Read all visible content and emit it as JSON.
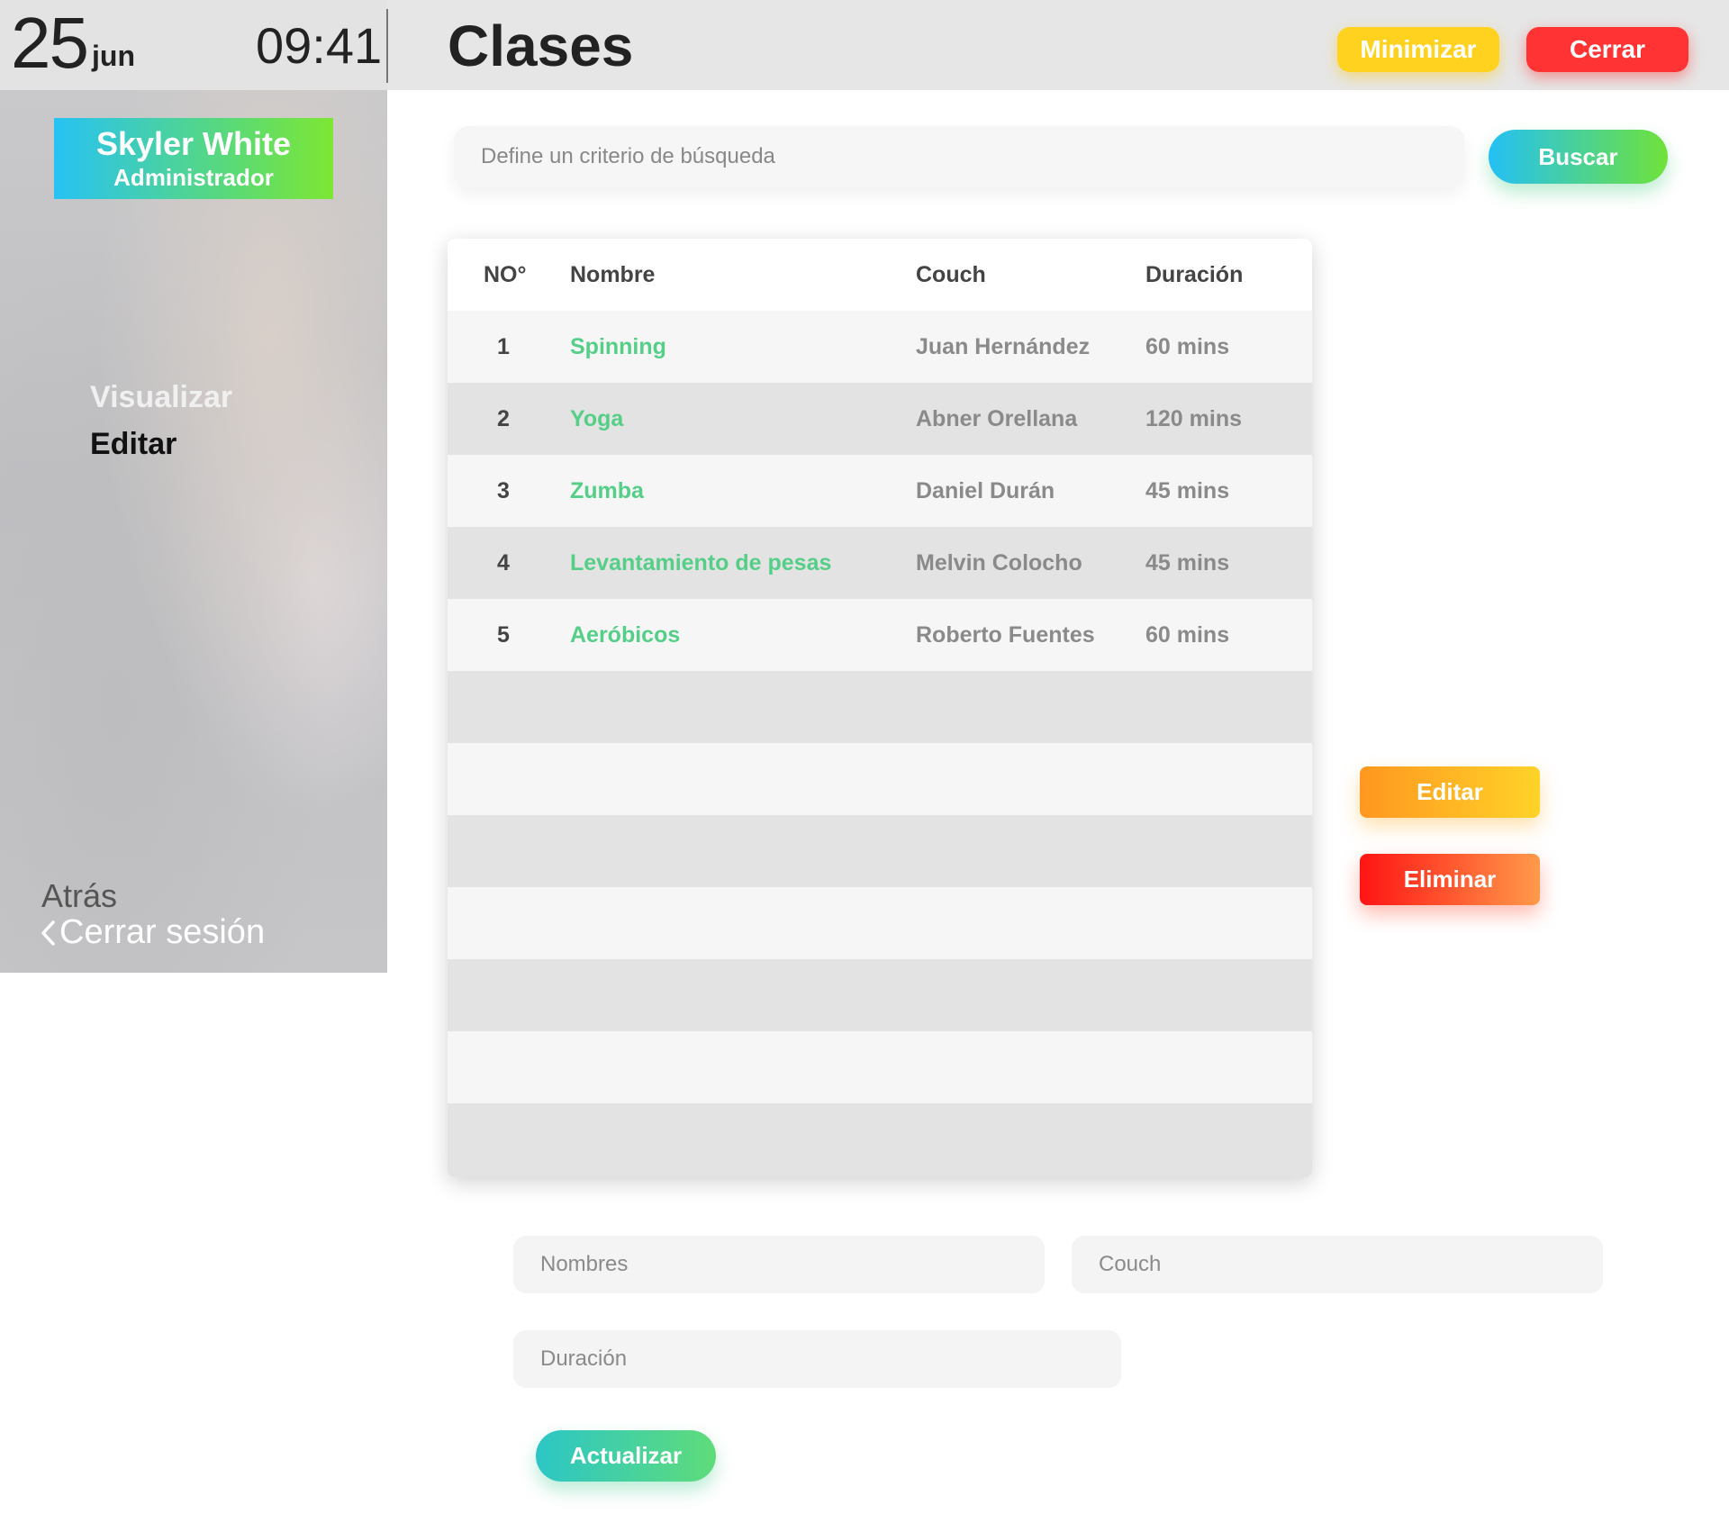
{
  "status": {
    "day": "25",
    "month": "jun",
    "time": "09:41"
  },
  "header": {
    "title": "Clases",
    "minimize_label": "Minimizar",
    "close_label": "Cerrar"
  },
  "sidebar": {
    "user_name": "Skyler White",
    "user_role": "Administrador",
    "nav_view": "Visualizar",
    "nav_edit": "Editar",
    "back_label": "Atrás",
    "logout_label": "Cerrar sesión"
  },
  "search": {
    "placeholder": "Define un criterio de búsqueda",
    "button_label": "Buscar"
  },
  "table": {
    "headers": {
      "number": "NO°",
      "name": "Nombre",
      "couch": "Couch",
      "duration": "Duración"
    },
    "rows": [
      {
        "number": "1",
        "name": "Spinning",
        "couch": "Juan Hernández",
        "duration": "60 mins"
      },
      {
        "number": "2",
        "name": "Yoga",
        "couch": "Abner Orellana",
        "duration": "120 mins"
      },
      {
        "number": "3",
        "name": "Zumba",
        "couch": "Daniel Durán",
        "duration": "45 mins"
      },
      {
        "number": "4",
        "name": "Levantamiento de pesas",
        "couch": "Melvin Colocho",
        "duration": "45 mins"
      },
      {
        "number": "5",
        "name": "Aeróbicos",
        "couch": "Roberto Fuentes",
        "duration": "60 mins"
      }
    ]
  },
  "actions": {
    "edit_label": "Editar",
    "delete_label": "Eliminar"
  },
  "form": {
    "names_placeholder": "Nombres",
    "couch_placeholder": "Couch",
    "duration_placeholder": "Duración",
    "update_label": "Actualizar"
  },
  "colors": {
    "accent_green": "#55cf88",
    "minimize": "#ffd21f",
    "close": "#ff3333",
    "edit": "#ff9720",
    "delete": "#ff1414"
  }
}
